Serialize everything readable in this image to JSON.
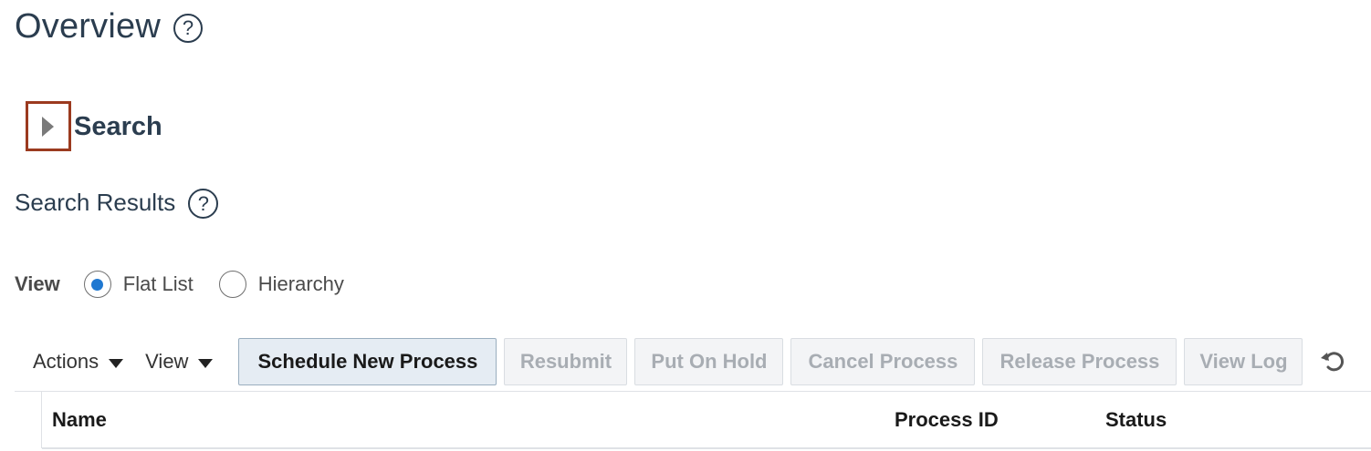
{
  "header": {
    "title": "Overview",
    "help_glyph": "?"
  },
  "search_section": {
    "title": "Search",
    "toggle_icon": "disclosure-collapsed-icon",
    "highlight_color": "#9b3a1f"
  },
  "results": {
    "title": "Search Results",
    "help_glyph": "?"
  },
  "view_mode": {
    "label": "View",
    "options": [
      {
        "label": "Flat List",
        "selected": true
      },
      {
        "label": "Hierarchy",
        "selected": false
      }
    ]
  },
  "toolbar": {
    "actions_label": "Actions",
    "view_label": "View",
    "schedule_label": "Schedule New Process",
    "resubmit_label": "Resubmit",
    "hold_label": "Put On Hold",
    "cancel_label": "Cancel Process",
    "release_label": "Release Process",
    "viewlog_label": "View Log",
    "refresh_icon": "refresh-icon"
  },
  "table": {
    "columns": [
      "Name",
      "Process ID",
      "Status"
    ]
  },
  "colors": {
    "title": "#2b3d4f",
    "radio_selected": "#1f78d1",
    "disabled_text": "#a8adb3"
  }
}
